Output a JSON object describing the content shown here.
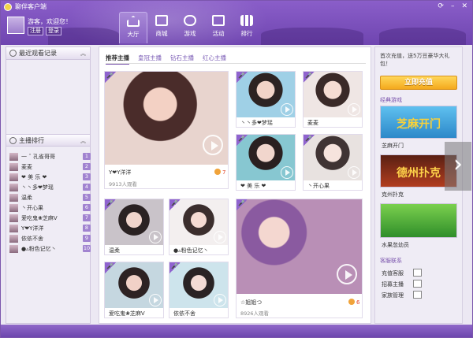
{
  "window": {
    "title": "聊伴客户端",
    "controls": [
      "⟳",
      "–",
      "✕"
    ]
  },
  "user": {
    "greeting": "游客，欢迎您！",
    "register_label": "注册",
    "login_label": "登录"
  },
  "nav": {
    "items": [
      {
        "label": "大厅",
        "icon": "home-icon",
        "active": true
      },
      {
        "label": "商城",
        "icon": "shopping-bag-icon",
        "active": false
      },
      {
        "label": "游戏",
        "icon": "gamepad-icon",
        "active": false
      },
      {
        "label": "活动",
        "icon": "calendar-icon",
        "active": false
      },
      {
        "label": "排行",
        "icon": "bar-chart-icon",
        "active": false
      }
    ]
  },
  "left": {
    "recent_title": "最近观看记录",
    "rank_title": "主播排行",
    "rank": [
      {
        "name": "一 ˆ 孔雀哥哥",
        "num": "1"
      },
      {
        "name": "麦麦",
        "num": "2"
      },
      {
        "name": "❤ 美 乐 ❤",
        "num": "3"
      },
      {
        "name": "丶丶多❤梦瑶",
        "num": "4"
      },
      {
        "name": "温柔",
        "num": "5"
      },
      {
        "name": "丶开心果",
        "num": "6"
      },
      {
        "name": "爱吃鬼❀芝麻Ⅴ",
        "num": "7"
      },
      {
        "name": "Y❤Y洋洋",
        "num": "8"
      },
      {
        "name": "依依不舍",
        "num": "9"
      },
      {
        "name": "●▵粉色记忆丶",
        "num": "10"
      }
    ]
  },
  "main": {
    "tabs": [
      {
        "label": "推荐主播",
        "active": true
      },
      {
        "label": "皇冠主播",
        "active": false
      },
      {
        "label": "钻石主播",
        "active": false
      },
      {
        "label": "红心主播",
        "active": false
      }
    ],
    "cards": {
      "big1": {
        "name": "Y❤Y洋洋",
        "views": "9913人观看",
        "heat": "7"
      },
      "s1": {
        "name": "丶丶多❤梦瑶"
      },
      "s2": {
        "name": "麦麦"
      },
      "s3": {
        "name": "❤ 美 乐 ❤"
      },
      "s4": {
        "name": "丶开心果"
      },
      "s5": {
        "name": "温柔"
      },
      "s6": {
        "name": "●▵粉色记忆丶"
      },
      "s7": {
        "name": "爱吃鬼❀芝麻Ⅴ"
      },
      "s8": {
        "name": "依依不舍"
      },
      "big2": {
        "name": "☆姐姐つ",
        "views": "8926人观看",
        "heat": "6"
      }
    }
  },
  "right": {
    "promo_text": "首次充值，送5万豆豪华大礼包！",
    "recharge_label": "立即充值",
    "games_title": "经典游戏",
    "games": [
      {
        "banner": "芝麻开门",
        "name": "芝麻开门"
      },
      {
        "banner": "德州扑克",
        "name": "克州扑克"
      },
      {
        "banner": "",
        "name": "水果忽幼员"
      }
    ],
    "service_title": "客服联系",
    "service": [
      "充值客服",
      "招募主播",
      "家族管理"
    ]
  },
  "colors": {
    "brand": "#7b55ad",
    "accent": "#f4a91d",
    "heat": "#e0452c"
  }
}
